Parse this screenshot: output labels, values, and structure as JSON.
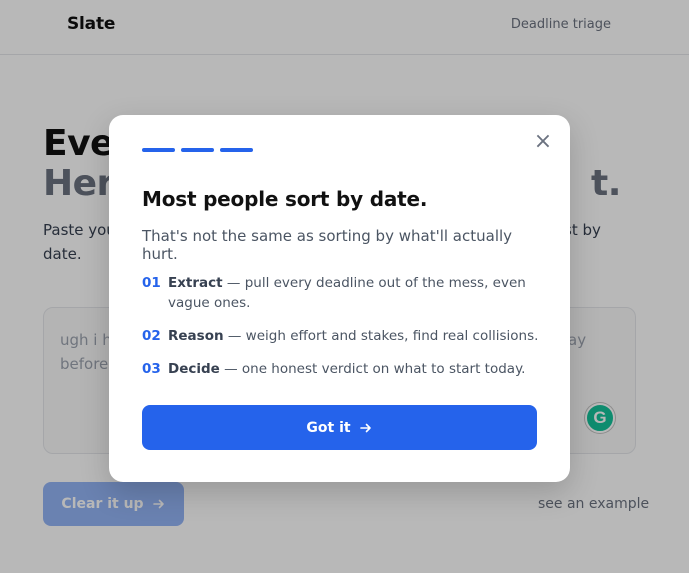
{
  "app": {
    "brand": "Slate",
    "nav_link": "Deadline triage"
  },
  "hero": {
    "title_line1": "Ever",
    "title_line2": "Here",
    "title_line2_tail": "t.",
    "subtitle": "Paste you",
    "subtitle_line2": "date.",
    "subtitle_tail": "st by"
  },
  "paste_box": {
    "text": "ugh i h",
    "text_line2": "before",
    "text_tail": "ay",
    "extension_badge": "G"
  },
  "actions": {
    "clear_label": "Clear it up",
    "example_link": "see an example"
  },
  "modal": {
    "progress_steps": 3,
    "close_icon": "×",
    "title": "Most people sort by date.",
    "subtitle": "That's not the same as sorting by what'll actually hurt.",
    "steps": [
      {
        "num": "01",
        "keyword": "Extract",
        "text": " — pull every deadline out of the mess, even vague ones."
      },
      {
        "num": "02",
        "keyword": "Reason",
        "text": " — weigh effort and stakes, find real collisions."
      },
      {
        "num": "03",
        "keyword": "Decide",
        "text": " — one honest verdict on what to start today."
      }
    ],
    "button_label": "Got it"
  },
  "colors": {
    "accent": "#2563eb",
    "accent_disabled": "#94b4f5",
    "overlay": "rgba(0,0,0,0.28)"
  }
}
